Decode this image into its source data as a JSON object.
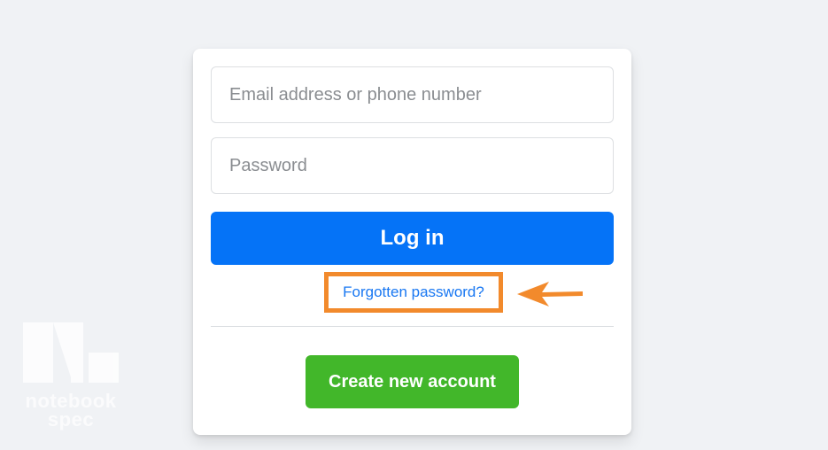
{
  "watermark": {
    "line1": "notebook",
    "line2": "spec"
  },
  "login_form": {
    "email_placeholder": "Email address or phone number",
    "email_value": "",
    "password_placeholder": "Password",
    "password_value": "",
    "login_label": "Log in",
    "forgot_label": "Forgotten password?",
    "create_label": "Create new account"
  },
  "colors": {
    "background": "#f0f2f5",
    "login_button": "#0573f7",
    "create_button": "#42b72a",
    "link": "#1877f2",
    "highlight": "#f28a2c"
  },
  "icons": {
    "annotation_arrow": "arrow-left-icon",
    "watermark_logo": "notebookspec-logo"
  }
}
